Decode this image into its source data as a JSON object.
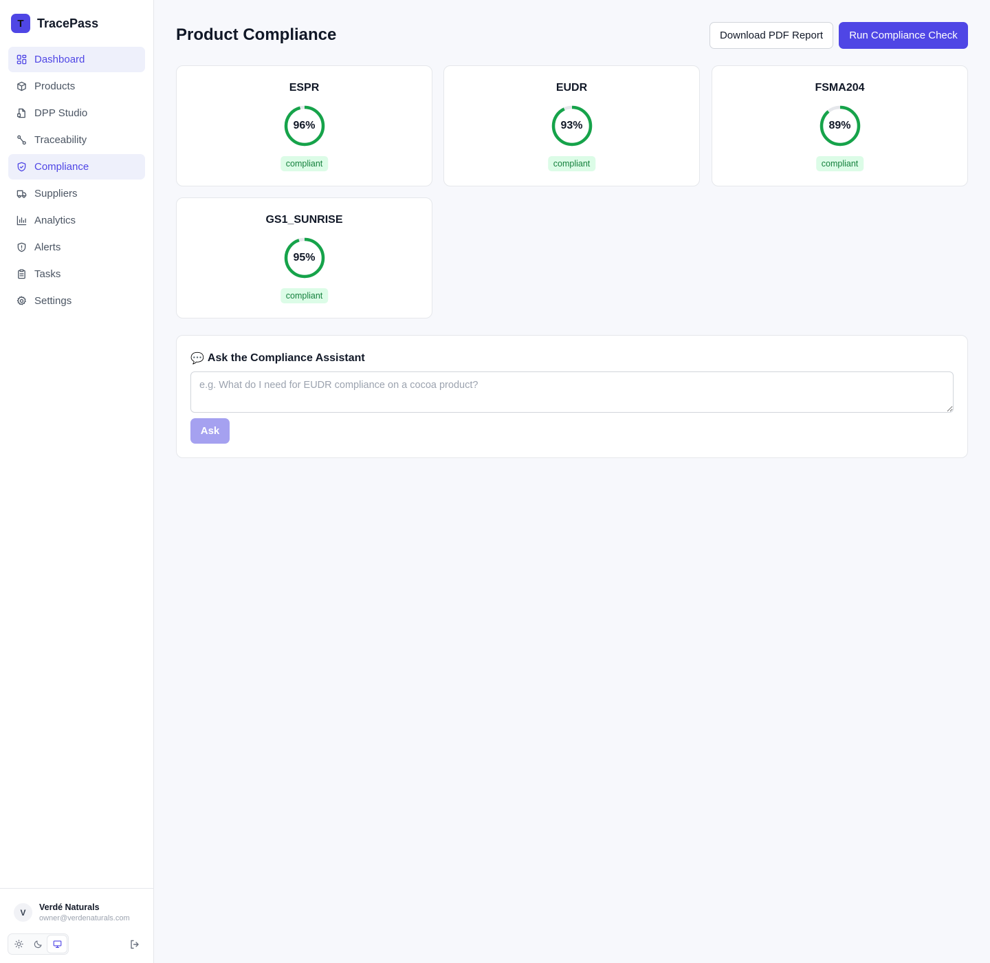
{
  "app": {
    "logo_letter": "T",
    "name": "TracePass"
  },
  "sidebar": {
    "items": [
      {
        "label": "Dashboard",
        "icon": "grid-icon"
      },
      {
        "label": "Products",
        "icon": "box-icon"
      },
      {
        "label": "DPP Studio",
        "icon": "file-icon"
      },
      {
        "label": "Traceability",
        "icon": "route-icon"
      },
      {
        "label": "Compliance",
        "icon": "shield-check-icon"
      },
      {
        "label": "Suppliers",
        "icon": "truck-icon"
      },
      {
        "label": "Analytics",
        "icon": "bar-chart-icon"
      },
      {
        "label": "Alerts",
        "icon": "shield-alert-icon"
      },
      {
        "label": "Tasks",
        "icon": "clipboard-icon"
      },
      {
        "label": "Settings",
        "icon": "gear-icon"
      }
    ]
  },
  "user": {
    "initial": "V",
    "name": "Verdé Naturals",
    "email": "owner@verdenaturals.com"
  },
  "theme": {
    "options": [
      "light",
      "dark",
      "system"
    ],
    "selected": "system"
  },
  "header": {
    "title": "Product Compliance",
    "download_label": "Download PDF Report",
    "run_label": "Run Compliance Check"
  },
  "frameworks": [
    {
      "name": "ESPR",
      "score": 96,
      "score_label": "96%",
      "status": "compliant"
    },
    {
      "name": "EUDR",
      "score": 93,
      "score_label": "93%",
      "status": "compliant"
    },
    {
      "name": "FSMA204",
      "score": 89,
      "score_label": "89%",
      "status": "compliant"
    },
    {
      "name": "GS1_SUNRISE",
      "score": 95,
      "score_label": "95%",
      "status": "compliant"
    }
  ],
  "assistant": {
    "title": "Ask the Compliance Assistant",
    "placeholder": "e.g. What do I need for EUDR compliance on a cocoa product?",
    "ask_label": "Ask"
  },
  "colors": {
    "accent": "#4f46e5",
    "success": "#16a34a",
    "badge_bg": "#dcfce7",
    "badge_text": "#15803d"
  }
}
